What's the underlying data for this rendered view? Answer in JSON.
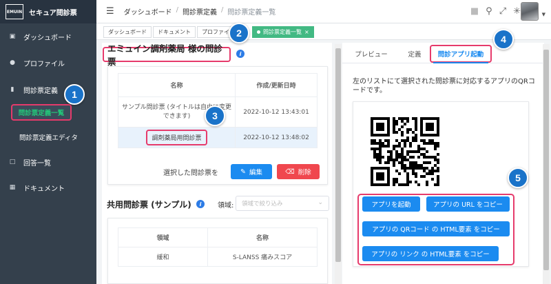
{
  "app": {
    "logo_text": "EMUIN",
    "name": "セキュア問診票"
  },
  "sidebar": {
    "items": [
      {
        "label": "ダッシュボード",
        "icon": "dashboard-icon"
      },
      {
        "label": "プロファイル",
        "icon": "user-icon"
      },
      {
        "label": "問診票定義",
        "icon": "clipboard-icon"
      },
      {
        "label": "問診票定義一覧",
        "icon": ""
      },
      {
        "label": "問診票定義エディタ",
        "icon": ""
      },
      {
        "label": "回答一覧",
        "icon": "window-icon"
      },
      {
        "label": "ドキュメント",
        "icon": "document-icon"
      }
    ]
  },
  "header": {
    "breadcrumb": [
      "ダッシュボード",
      "問診票定義",
      "問診票定義一覧"
    ],
    "icons": [
      "lock-icon",
      "search-icon",
      "fullscreen-icon",
      "bug-icon"
    ]
  },
  "tags": [
    "ダッシュボード",
    "ドキュメント",
    "プロファイ",
    "問診票定義一覧"
  ],
  "left": {
    "title": "エミュイン調剤薬局 様の問診票",
    "table1": {
      "headers": [
        "名称",
        "作成/更新日時"
      ],
      "rows": [
        [
          "サンプル問診票 (タイトルは自由に変更できます)",
          "2022-10-12 13:43:01"
        ],
        [
          "調剤薬局用問診票",
          "2022-10-12 13:48:02"
        ]
      ]
    },
    "selected_label": "選択した問診票を",
    "edit_label": "編集",
    "delete_label": "削除",
    "shared_title": "共用問診票 (サンプル)",
    "domain_label": "領域:",
    "domain_placeholder": "領域で絞り込み",
    "table2": {
      "headers": [
        "領域",
        "名称"
      ],
      "rows": [
        [
          "緩和",
          "S-LANSS 痛みスコア"
        ]
      ]
    }
  },
  "right": {
    "tabs": [
      "プレビュー",
      "定義",
      "問診アプリ起動"
    ],
    "active_tab": "問診アプリ起動",
    "description": "左のリストにて選択された問診票に対応するアプリのQRコードです。",
    "buttons": [
      "アプリを起動",
      "アプリの URL をコピー",
      "アプリの QRコード の HTML要素 をコピー",
      "アプリの リンク の HTML要素 をコピー"
    ]
  },
  "callouts": [
    "1",
    "2",
    "3",
    "4",
    "5"
  ],
  "colors": {
    "sidebar_bg": "#34404c",
    "accent_green": "#42b983",
    "primary_blue": "#1b8bf0",
    "danger_red": "#f0474e",
    "highlight_pink": "#e63a6b",
    "callout_blue": "#1a73c9"
  }
}
